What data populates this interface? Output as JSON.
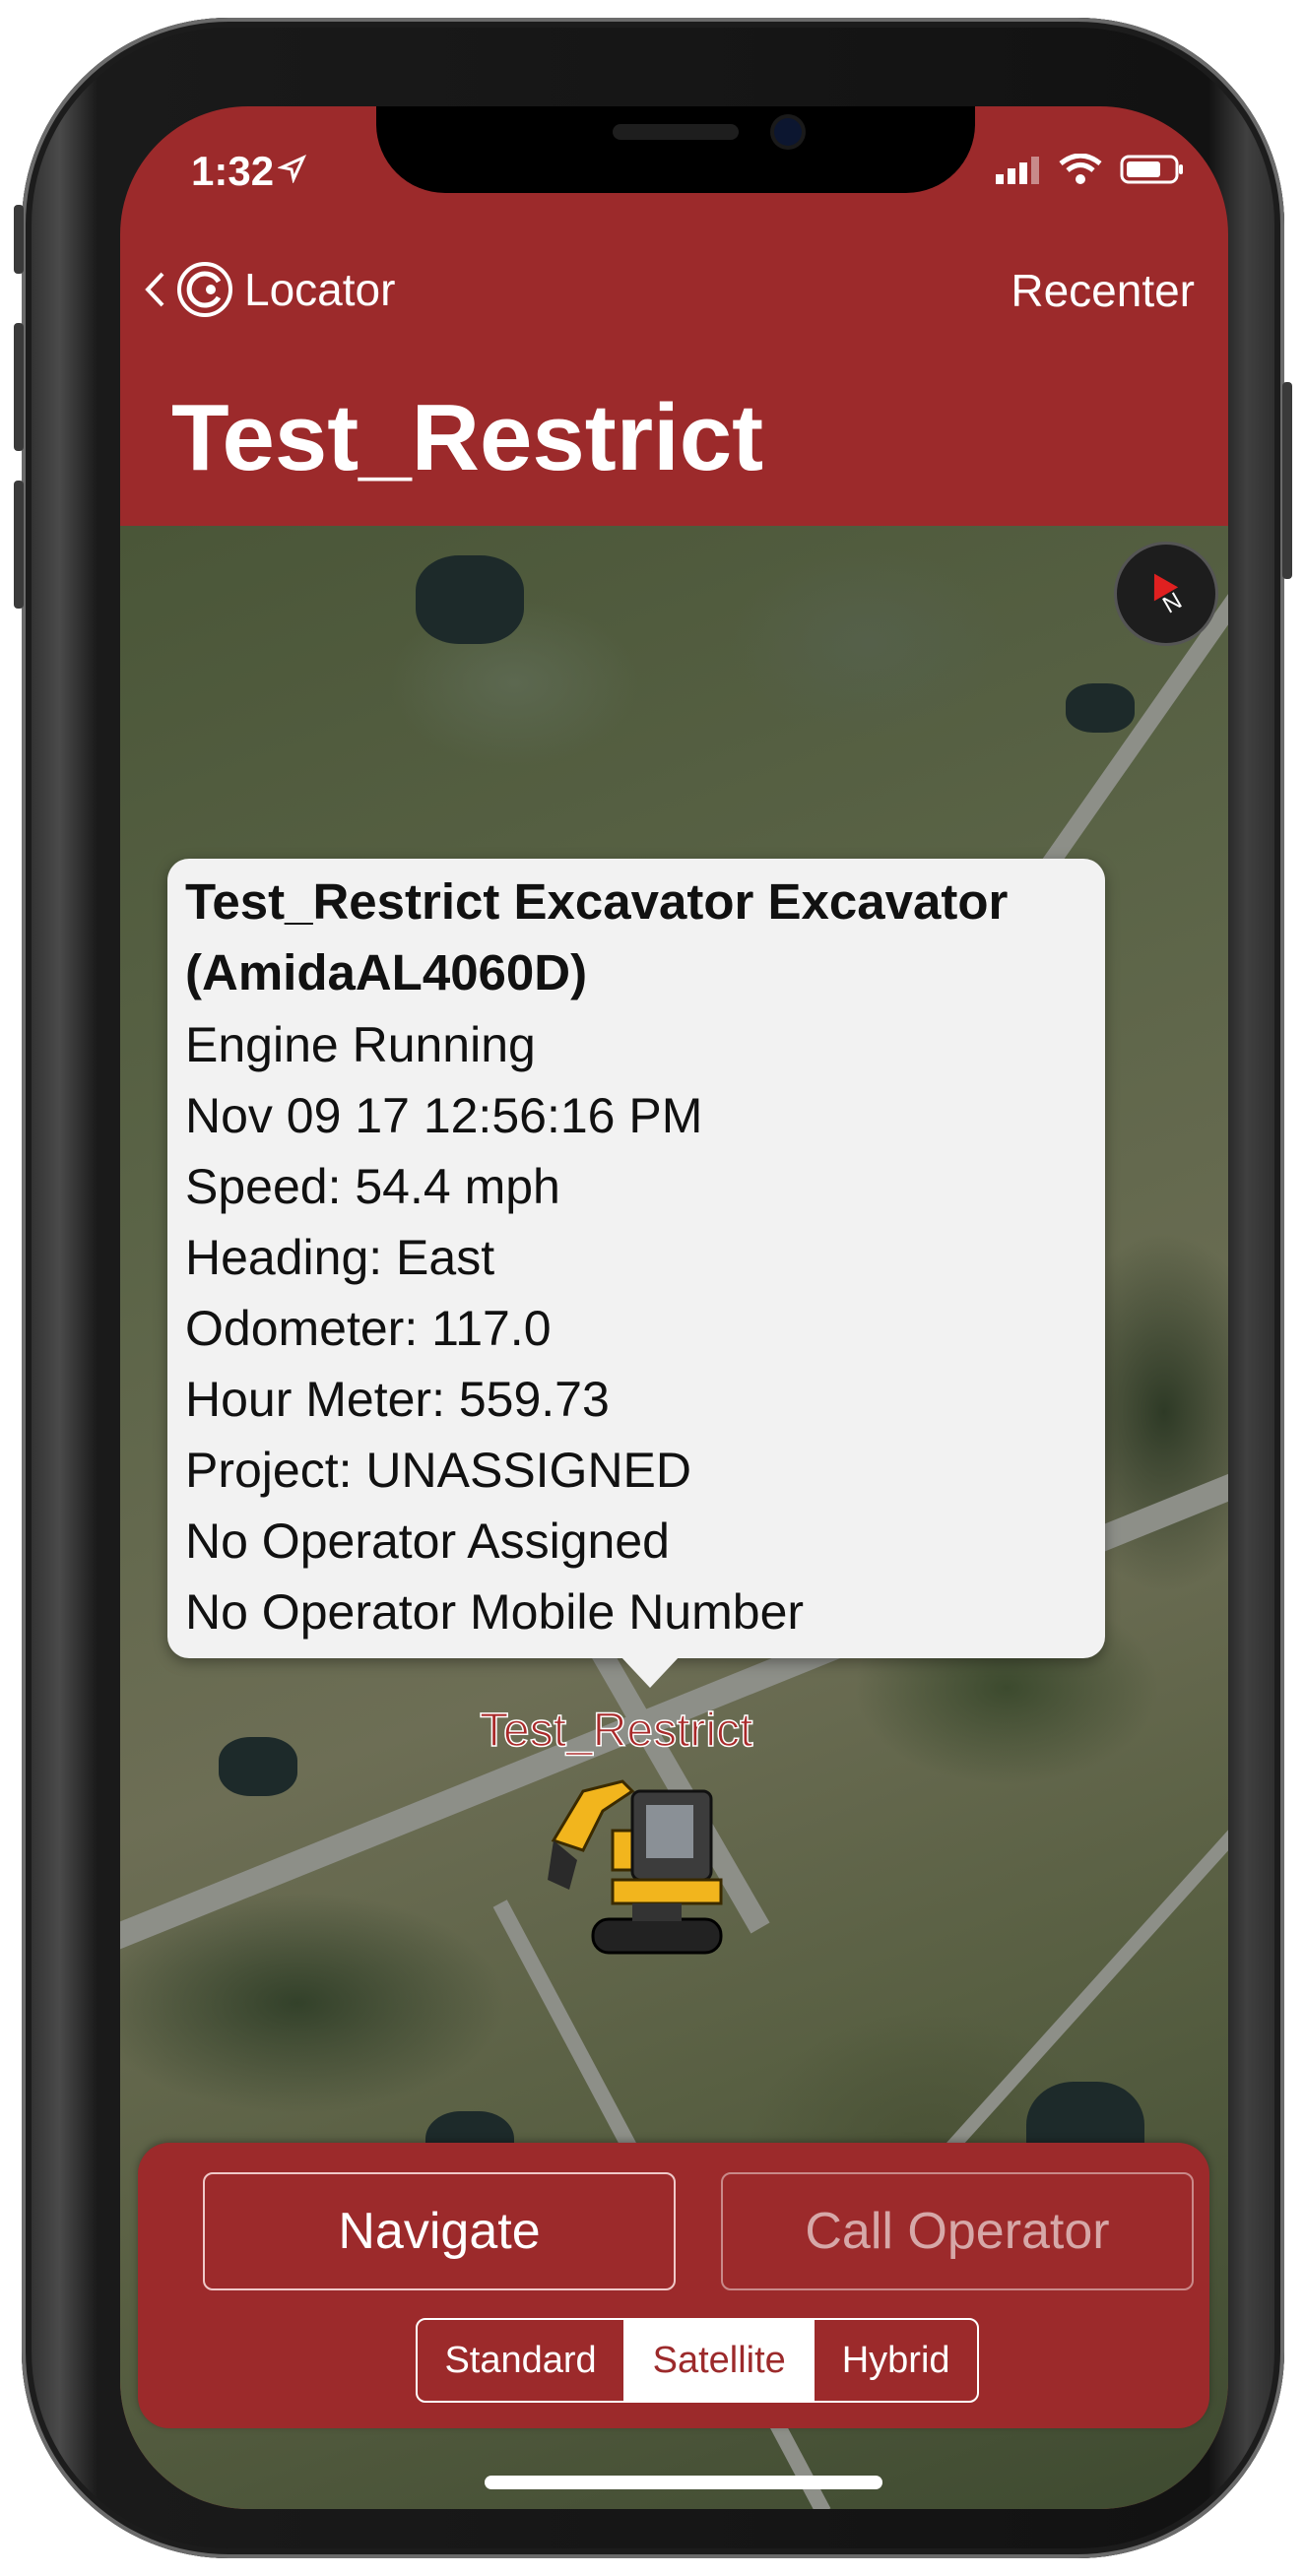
{
  "status_bar": {
    "time": "1:32"
  },
  "nav": {
    "back_label": "Locator",
    "recenter_label": "Recenter"
  },
  "page": {
    "title": "Test_Restrict"
  },
  "callout": {
    "title_line1": "Test_Restrict Excavator Excavator",
    "title_line2": "(AmidaAL4060D)",
    "lines": [
      "Engine Running",
      "Nov 09 17 12:56:16 PM",
      "Speed: 54.4 mph",
      "Heading: East",
      "Odometer: 117.0",
      "Hour Meter: 559.73",
      "Project: UNASSIGNED",
      "No Operator Assigned",
      "No Operator Mobile Number"
    ]
  },
  "map": {
    "pin_label": "Test_Restrict",
    "compass_letter": "N"
  },
  "actions": {
    "navigate_label": "Navigate",
    "call_label": "Call Operator"
  },
  "map_type": {
    "options": [
      "Standard",
      "Satellite",
      "Hybrid"
    ],
    "selected": "Satellite"
  },
  "colors": {
    "accent": "#9c2a2b"
  }
}
